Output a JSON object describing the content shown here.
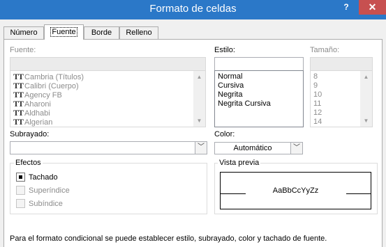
{
  "window": {
    "title": "Formato de celdas",
    "help_label": "?",
    "close_label": "✕"
  },
  "tabs": [
    {
      "label": "Número"
    },
    {
      "label": "Fuente"
    },
    {
      "label": "Borde"
    },
    {
      "label": "Relleno"
    }
  ],
  "active_tab": "Fuente",
  "font": {
    "label": "Fuente:",
    "value": "",
    "items": [
      "Cambria (Títulos)",
      "Calibri (Cuerpo)",
      "Agency FB",
      "Aharoni",
      "Aldhabi",
      "Algerian"
    ]
  },
  "style": {
    "label": "Estilo:",
    "value": "",
    "items": [
      "Normal",
      "Cursiva",
      "Negrita",
      "Negrita Cursiva"
    ]
  },
  "size": {
    "label": "Tamaño:",
    "value": "",
    "items": [
      "8",
      "9",
      "10",
      "11",
      "12",
      "14"
    ]
  },
  "underline": {
    "label": "Subrayado:",
    "value": ""
  },
  "color": {
    "label": "Color:",
    "value": "Automático"
  },
  "effects": {
    "title": "Efectos",
    "strikethrough": {
      "label": "Tachado",
      "checked": true
    },
    "superscript": {
      "label": "Superíndice",
      "checked": false
    },
    "subscript": {
      "label": "Subíndice",
      "checked": false
    }
  },
  "preview": {
    "title": "Vista previa",
    "sample": "AaBbCcYyZz"
  },
  "note": "Para el formato condicional se puede establecer estilo, subrayado, color y tachado de fuente.",
  "icons": {
    "font_type": "tt-truetype-icon",
    "dropdown": "chevron-down-icon",
    "scroll_up": "triangle-up-icon",
    "scroll_down": "triangle-down-icon"
  },
  "colors": {
    "titlebar": "#2b78c8",
    "close": "#c75050",
    "dialog": "#f0f0f0",
    "disabled_text": "#8c8c8c"
  }
}
